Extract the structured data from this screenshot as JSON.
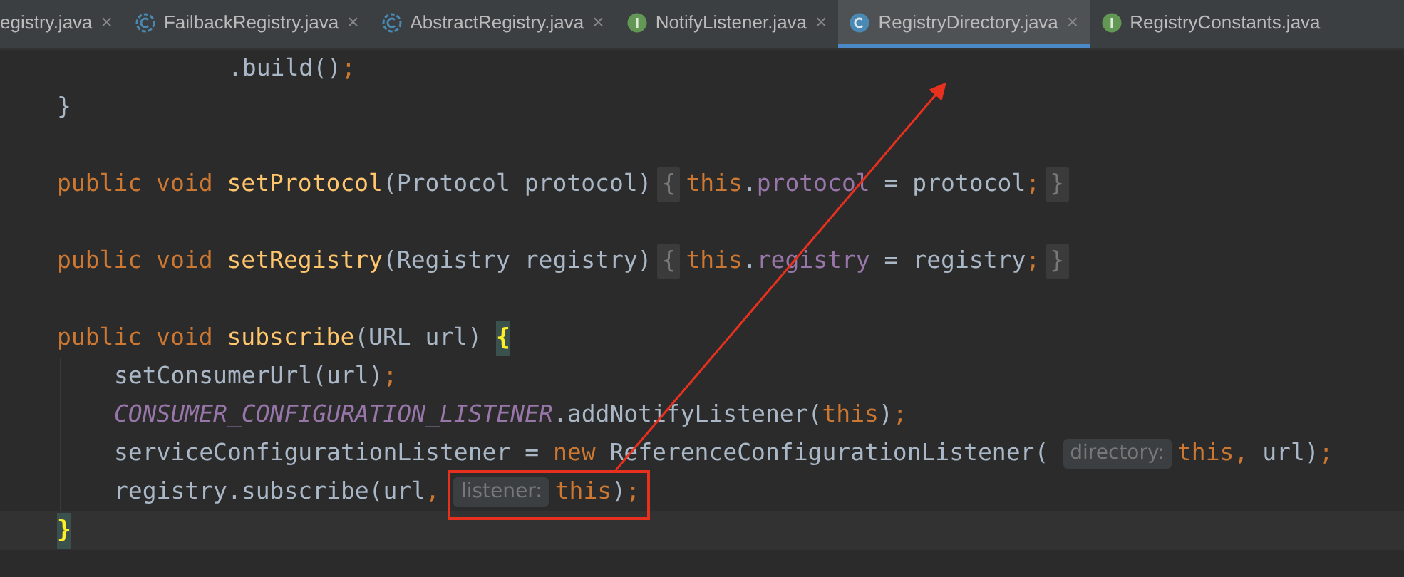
{
  "tabs": [
    {
      "label": "egistry.java",
      "kind": "none",
      "selected": false,
      "closable": true
    },
    {
      "label": "FailbackRegistry.java",
      "kind": "abstract",
      "selected": false,
      "closable": true
    },
    {
      "label": "AbstractRegistry.java",
      "kind": "abstract",
      "selected": false,
      "closable": true
    },
    {
      "label": "NotifyListener.java",
      "kind": "interface",
      "selected": false,
      "closable": true
    },
    {
      "label": "RegistryDirectory.java",
      "kind": "class",
      "selected": true,
      "closable": true
    },
    {
      "label": "RegistryConstants.java",
      "kind": "interface",
      "selected": false,
      "closable": false
    }
  ],
  "close_glyph": "×",
  "lines": [
    {
      "kind": "chain",
      "tokens": [
        {
          "kind": "plain",
          "text": ".build()"
        },
        {
          "kind": "punct",
          "text": ";"
        }
      ]
    },
    {
      "kind": "member",
      "tokens": [
        {
          "kind": "plain",
          "text": "}"
        }
      ]
    },
    {
      "kind": "blank"
    },
    {
      "kind": "member",
      "tokens": [
        {
          "kind": "keyword",
          "text": "public void "
        },
        {
          "kind": "function",
          "text": "setProtocol"
        },
        {
          "kind": "plain",
          "text": "(Protocol protocol)"
        },
        {
          "kind": "fold",
          "text": "{"
        },
        {
          "kind": "keyword",
          "text": "this"
        },
        {
          "kind": "plain",
          "text": "."
        },
        {
          "kind": "field",
          "text": "protocol"
        },
        {
          "kind": "plain",
          "text": " = protocol"
        },
        {
          "kind": "punct",
          "text": ";"
        },
        {
          "kind": "fold",
          "text": "}"
        }
      ]
    },
    {
      "kind": "blank"
    },
    {
      "kind": "member",
      "tokens": [
        {
          "kind": "keyword",
          "text": "public void "
        },
        {
          "kind": "function",
          "text": "setRegistry"
        },
        {
          "kind": "plain",
          "text": "(Registry registry)"
        },
        {
          "kind": "fold",
          "text": "{"
        },
        {
          "kind": "keyword",
          "text": "this"
        },
        {
          "kind": "plain",
          "text": "."
        },
        {
          "kind": "field",
          "text": "registry"
        },
        {
          "kind": "plain",
          "text": " = registry"
        },
        {
          "kind": "punct",
          "text": ";"
        },
        {
          "kind": "fold",
          "text": "}"
        }
      ]
    },
    {
      "kind": "blank"
    },
    {
      "kind": "member",
      "tokens": [
        {
          "kind": "keyword",
          "text": "public void "
        },
        {
          "kind": "function",
          "text": "subscribe"
        },
        {
          "kind": "plain",
          "text": "(URL url) "
        },
        {
          "kind": "match",
          "text": "{"
        }
      ]
    },
    {
      "kind": "statement",
      "tokens": [
        {
          "kind": "plain",
          "text": "setConsumerUrl(url)"
        },
        {
          "kind": "punct",
          "text": ";"
        }
      ]
    },
    {
      "kind": "statement",
      "tokens": [
        {
          "kind": "constant",
          "text": "CONSUMER_CONFIGURATION_LISTENER"
        },
        {
          "kind": "plain",
          "text": ".addNotifyListener("
        },
        {
          "kind": "keyword",
          "text": "this"
        },
        {
          "kind": "plain",
          "text": ")"
        },
        {
          "kind": "punct",
          "text": ";"
        }
      ]
    },
    {
      "kind": "statement",
      "tokens": [
        {
          "kind": "plain",
          "text": "serviceConfigurationListener = "
        },
        {
          "kind": "keyword",
          "text": "new "
        },
        {
          "kind": "plain",
          "text": "ReferenceConfigurationListener("
        },
        {
          "kind": "hint",
          "text": "directory:"
        },
        {
          "kind": "keyword",
          "text": "this"
        },
        {
          "kind": "punct",
          "text": ","
        },
        {
          "kind": "plain",
          "text": " url)"
        },
        {
          "kind": "punct",
          "text": ";"
        }
      ]
    },
    {
      "kind": "statement",
      "tokens": [
        {
          "kind": "plain",
          "text": "registry.subscribe(url"
        },
        {
          "kind": "punct",
          "text": ","
        },
        {
          "kind": "hint",
          "text": "listener:"
        },
        {
          "kind": "keyword",
          "text": "this"
        },
        {
          "kind": "plain",
          "text": ")"
        },
        {
          "kind": "punct",
          "text": ";"
        }
      ]
    },
    {
      "kind": "caret_member",
      "tokens": [
        {
          "kind": "match",
          "text": "}"
        }
      ]
    }
  ]
}
